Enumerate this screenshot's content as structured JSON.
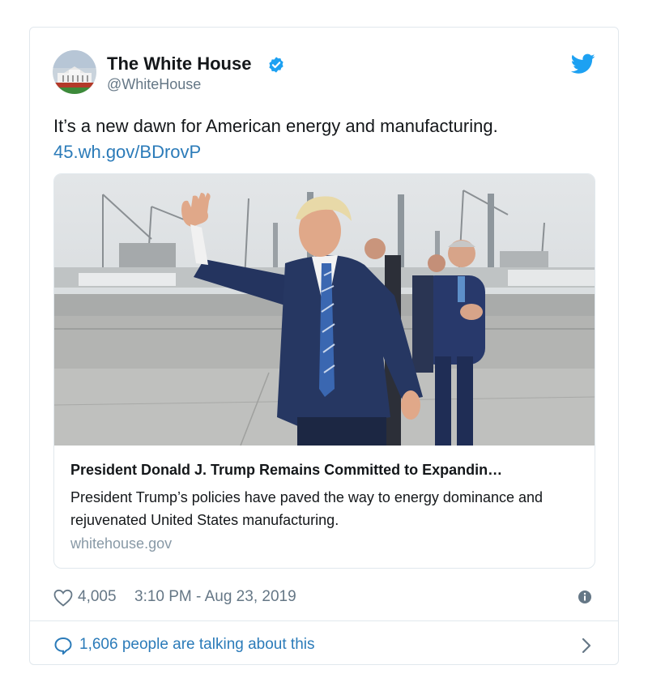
{
  "tweet": {
    "author_name": "The White House",
    "author_handle": "@WhiteHouse",
    "text": "It’s a new dawn for American energy and manufacturing.",
    "link": "45.wh.gov/BDrovP"
  },
  "link_card": {
    "title": "President Donald J. Trump Remains Committed to Expandin…",
    "description": "President Trump’s policies have paved the way to energy dominance and rejuvenated United States manufacturing.",
    "domain": "whitehouse.gov"
  },
  "stats": {
    "likes": "4,005",
    "timestamp": "3:10 PM - Aug 23, 2019"
  },
  "conversation": {
    "text": "1,606 people are talking about this"
  },
  "colors": {
    "twitter_blue": "#1da1f2",
    "link_blue": "#2b7bb9",
    "secondary_gray": "#657786",
    "border": "#e1e8ed"
  },
  "icons": [
    "verified-badge-icon",
    "twitter-bird-icon",
    "heart-icon",
    "info-icon",
    "reply-bubble-icon",
    "chevron-right-icon"
  ]
}
